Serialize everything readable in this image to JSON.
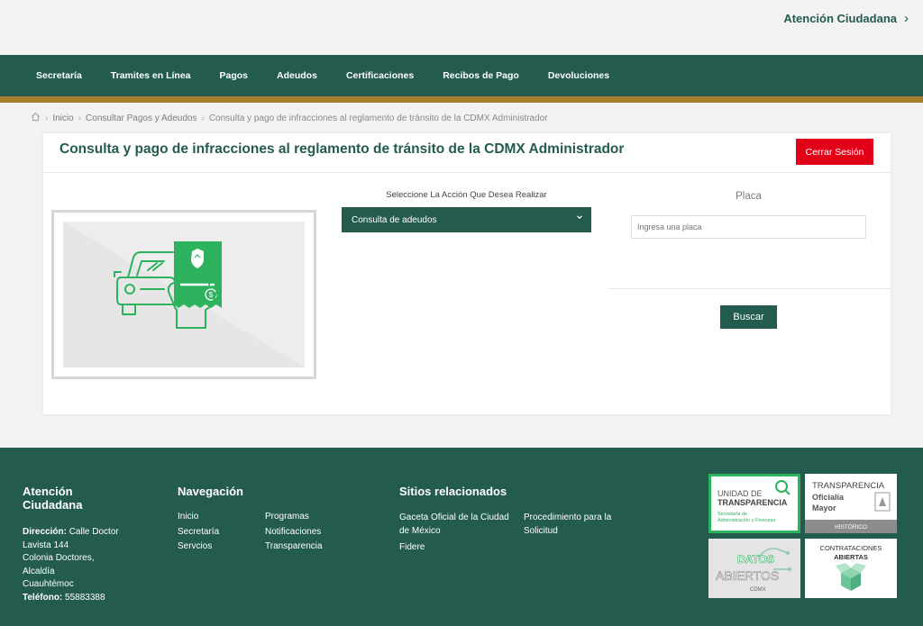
{
  "topbar": {
    "link": "Atención Ciudadana"
  },
  "nav": [
    "Secretaría",
    "Tramites en Línea",
    "Pagos",
    "Adeudos",
    "Certificaciones",
    "Recibos de Pago",
    "Devoluciones"
  ],
  "breadcrumb": {
    "items": [
      "Inicio",
      "Consultar Pagos y Adeudos",
      "Consulta y pago de infracciones al reglamento de tránsito de la CDMX Administrador"
    ]
  },
  "card": {
    "title": "Consulta y pago de infracciones al reglamento de tránsito de la CDMX Administrador",
    "logout": "Cerrar Sesión",
    "action_label": "Seleccione La Acción Que Desea Realizar",
    "action_value": "Consulta de adeudos",
    "placa_label": "Placa",
    "placa_placeholder": "Ingresa una placa",
    "search_button": "Buscar"
  },
  "colors": {
    "primary": "#235b4e",
    "gold": "#a57f2c",
    "danger": "#e10017",
    "illustration": "#2db35d"
  },
  "footer": {
    "atencion": {
      "title_line1": "Atención",
      "title_line2": "Ciudadana",
      "dir_label": "Dirección:",
      "dir_1": "Calle Doctor",
      "dir_2": "Lavista 144",
      "dir_3": "Colonia Doctores,",
      "dir_4": "Alcaldía",
      "dir_5": "Cuauhtémoc",
      "tel_label": "Teléfono:",
      "tel": "55883388"
    },
    "navegacion": {
      "title": "Navegación",
      "col1": [
        "Inicio",
        "Secretaría",
        "Servcios"
      ],
      "col2": [
        "Programas",
        "Notificaciones",
        "Transparencia"
      ]
    },
    "sitios": {
      "title": "Sitios relacionados",
      "gaceta_1": "Gaceta Oficial de la Ciudad",
      "gaceta_2": "de México",
      "proc_1": "Procedimiento para la",
      "proc_2": "Solicitud",
      "fidere": "Fidere"
    },
    "logos": {
      "ut_1": "UNIDAD DE",
      "ut_2": "TRANSPARENCIA",
      "ut_3": "Secretaría de",
      "ut_4": "Administración y Finanzas",
      "tom_1": "TRANSPARENCIA",
      "tom_2": "Oficialía",
      "tom_3": "Mayor",
      "tom_4": "HISTÓRICO",
      "da_1": "DATOS",
      "da_2": "ABIERTOS",
      "da_3": "CDMX",
      "ca_1": "CONTRATACIONES",
      "ca_2": "ABIERTAS"
    }
  }
}
